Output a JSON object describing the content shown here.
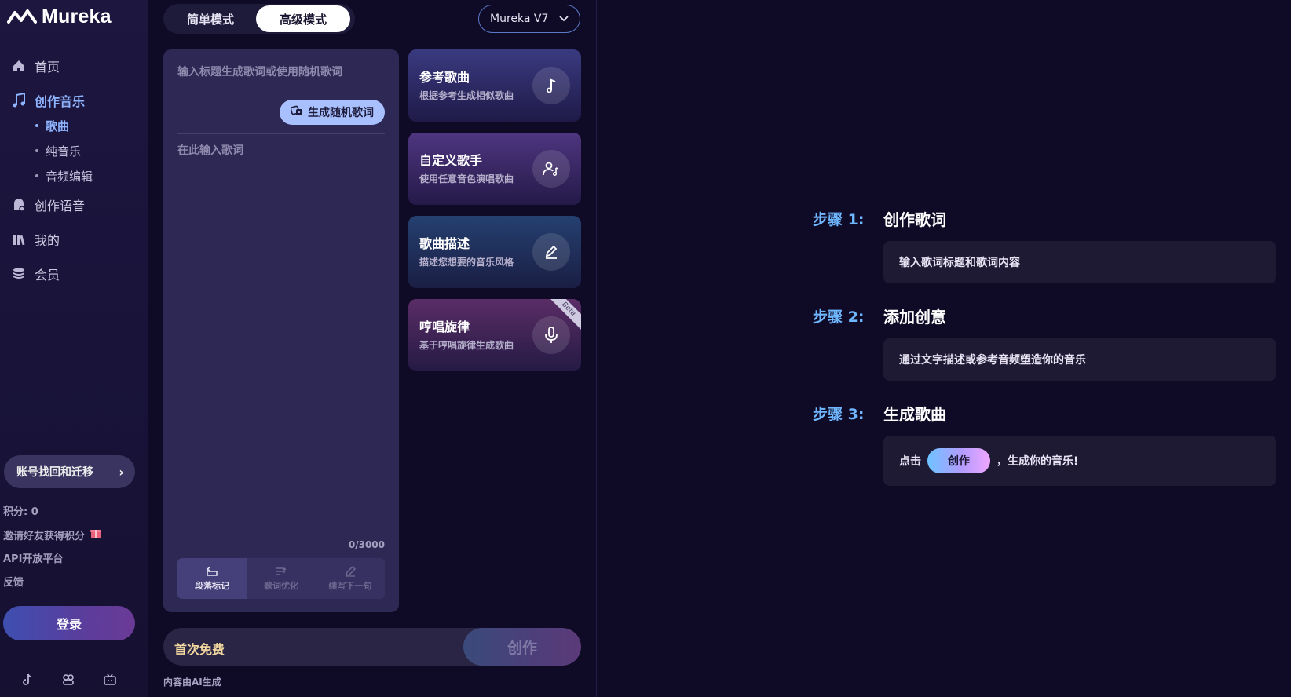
{
  "app": {
    "name": "Mureka"
  },
  "sidebar": {
    "nav": [
      {
        "label": "首页",
        "icon": "home-icon"
      },
      {
        "label": "创作音乐",
        "icon": "music-note-icon"
      },
      {
        "label": "创作语音",
        "icon": "voice-icon"
      },
      {
        "label": "我的",
        "icon": "library-icon"
      },
      {
        "label": "会员",
        "icon": "coins-icon"
      }
    ],
    "sub": [
      {
        "label": "歌曲"
      },
      {
        "label": "纯音乐"
      },
      {
        "label": "音频编辑"
      }
    ],
    "account_button": "账号找回和迁移",
    "points": "积分: 0",
    "invite": "邀请好友获得积分",
    "api": "API开放平台",
    "feedback": "反馈",
    "login": "登录",
    "social": [
      "tiktok-icon",
      "discord-icon",
      "bilibili-icon"
    ]
  },
  "header": {
    "mode_simple": "简单模式",
    "mode_advanced": "高级模式",
    "model": "Mureka V7"
  },
  "lyrics": {
    "title_placeholder": "输入标题生成歌词或使用随机歌词",
    "random_button": "生成随机歌词",
    "lyrics_placeholder": "在此输入歌词",
    "count": "0/3000",
    "tools": [
      "段落标记",
      "歌词优化",
      "续写下一句"
    ]
  },
  "cards": [
    {
      "title": "参考歌曲",
      "sub": "根据参考生成相似歌曲",
      "icon": "music-note-icon"
    },
    {
      "title": "自定义歌手",
      "sub": "使用任意音色演唱歌曲",
      "icon": "singer-icon"
    },
    {
      "title": "歌曲描述",
      "sub": "描述您想要的音乐风格",
      "icon": "pen-icon"
    },
    {
      "title": "哼唱旋律",
      "sub": "基于哼唱旋律生成歌曲",
      "icon": "microphone-icon",
      "badge": "Beta"
    }
  ],
  "footer": {
    "free": "首次免费",
    "create": "创作",
    "ai_note": "内容由AI生成"
  },
  "steps": [
    {
      "label": "步骤 1:",
      "title": "创作歌词",
      "text": "输入歌词标题和歌词内容"
    },
    {
      "label": "步骤 2:",
      "title": "添加创意",
      "text": "通过文字描述或参考音频塑造你的音乐"
    },
    {
      "label": "步骤 3:",
      "title": "生成歌曲",
      "pre": "点击",
      "pill": "创作",
      "post": "，生成你的音乐!"
    }
  ]
}
